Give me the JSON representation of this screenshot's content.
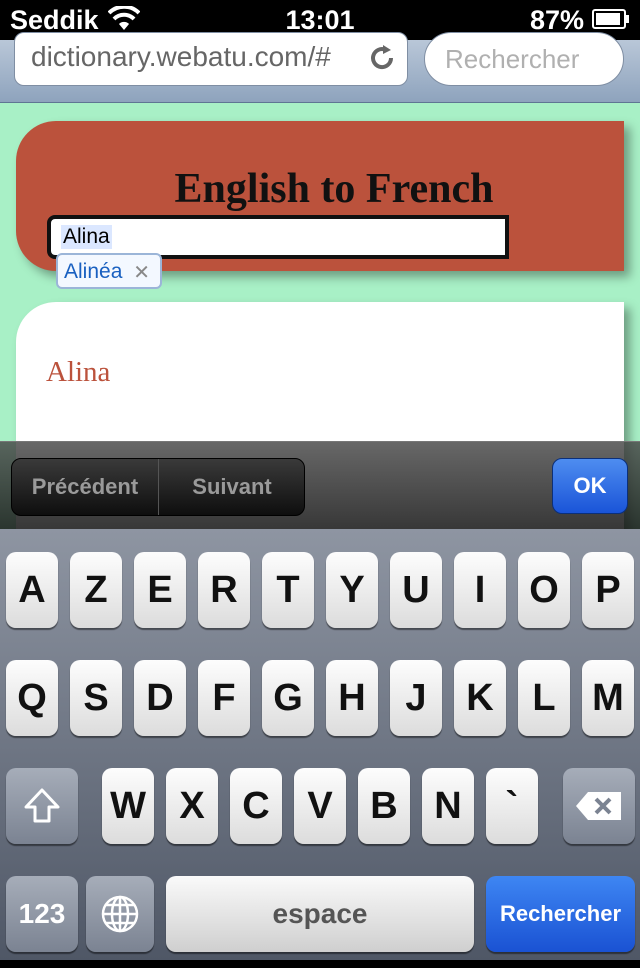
{
  "status_bar": {
    "carrier": "Seddik",
    "time": "13:01",
    "battery": "87%"
  },
  "browser": {
    "url": "dictionary.webatu.com/#",
    "search_placeholder": "Rechercher"
  },
  "page": {
    "title": "English to French",
    "search_value": "Alina",
    "autocorrect_suggestion": "Alinéa",
    "result_word": "Alina"
  },
  "form_bar": {
    "previous_label": "Précédent",
    "next_label": "Suivant",
    "ok_label": "OK"
  },
  "keyboard": {
    "row1": [
      "A",
      "Z",
      "E",
      "R",
      "T",
      "Y",
      "U",
      "I",
      "O",
      "P"
    ],
    "row2": [
      "Q",
      "S",
      "D",
      "F",
      "G",
      "H",
      "J",
      "K",
      "L",
      "M"
    ],
    "row3": [
      "W",
      "X",
      "C",
      "V",
      "B",
      "N",
      "`"
    ],
    "numbers_label": "123",
    "space_label": "espace",
    "return_label": "Rechercher"
  }
}
